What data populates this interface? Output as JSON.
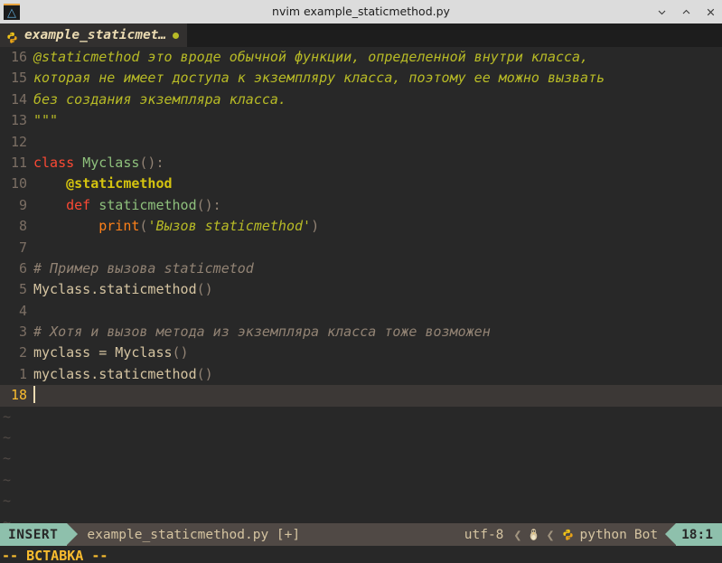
{
  "window": {
    "title": "nvim example_staticmethod.py",
    "app_icon": "neovim-icon",
    "controls": [
      {
        "name": "minimize-button",
        "glyph": "chevron-down-icon"
      },
      {
        "name": "maximize-button",
        "glyph": "chevron-up-icon"
      },
      {
        "name": "close-button",
        "glyph": "close-icon"
      }
    ]
  },
  "tabline": {
    "active_tab": {
      "icon": "python-icon",
      "label": "example_staticmet…",
      "modified_indicator": "●"
    }
  },
  "editor": {
    "lines": [
      {
        "num": "16",
        "tokens": [
          {
            "cls": "t-doc",
            "text": "@staticmethod это вроде обычной функции, определенной внутри класса,"
          }
        ]
      },
      {
        "num": "15",
        "tokens": [
          {
            "cls": "t-doc",
            "text": "которая не имеет доступа к экземпляру класса, поэтому ее можно вызвать"
          }
        ]
      },
      {
        "num": "14",
        "tokens": [
          {
            "cls": "t-doc",
            "text": "без создания экземпляра класса."
          }
        ]
      },
      {
        "num": "13",
        "tokens": [
          {
            "cls": "t-doc",
            "text": "\"\"\""
          }
        ]
      },
      {
        "num": "12",
        "tokens": []
      },
      {
        "num": "11",
        "tokens": [
          {
            "cls": "t-kw",
            "text": "class"
          },
          {
            "cls": "t-op",
            "text": " "
          },
          {
            "cls": "t-fn",
            "text": "Myclass"
          },
          {
            "cls": "t-punc",
            "text": "():"
          }
        ]
      },
      {
        "num": "10",
        "tokens": [
          {
            "cls": "t-op",
            "text": "    "
          },
          {
            "cls": "t-deco",
            "text": "@staticmethod"
          }
        ]
      },
      {
        "num": "9",
        "tokens": [
          {
            "cls": "t-op",
            "text": "    "
          },
          {
            "cls": "t-kw",
            "text": "def"
          },
          {
            "cls": "t-op",
            "text": " "
          },
          {
            "cls": "t-fn",
            "text": "staticmethod"
          },
          {
            "cls": "t-punc",
            "text": "():"
          }
        ]
      },
      {
        "num": "8",
        "tokens": [
          {
            "cls": "t-op",
            "text": "        "
          },
          {
            "cls": "t-builtin",
            "text": "print"
          },
          {
            "cls": "t-punc",
            "text": "("
          },
          {
            "cls": "t-str",
            "text": "'Вызов staticmethod'"
          },
          {
            "cls": "t-punc",
            "text": ")"
          }
        ]
      },
      {
        "num": "7",
        "tokens": []
      },
      {
        "num": "6",
        "tokens": [
          {
            "cls": "t-cmt",
            "text": "# Пример вызова staticmetod"
          }
        ]
      },
      {
        "num": "5",
        "tokens": [
          {
            "cls": "t-text",
            "text": "Myclass.staticmethod"
          },
          {
            "cls": "t-punc",
            "text": "()"
          }
        ]
      },
      {
        "num": "4",
        "tokens": []
      },
      {
        "num": "3",
        "tokens": [
          {
            "cls": "t-cmt",
            "text": "# Хотя и вызов метода из экземпляра класса тоже возможен"
          }
        ]
      },
      {
        "num": "2",
        "tokens": [
          {
            "cls": "t-text",
            "text": "myclass "
          },
          {
            "cls": "t-op",
            "text": "="
          },
          {
            "cls": "t-text",
            "text": " Myclass"
          },
          {
            "cls": "t-punc",
            "text": "()"
          }
        ]
      },
      {
        "num": "1",
        "tokens": [
          {
            "cls": "t-text",
            "text": "myclass.staticmethod"
          },
          {
            "cls": "t-punc",
            "text": "()"
          }
        ]
      }
    ],
    "cursor_line": {
      "num": "18",
      "text": ""
    },
    "empty_markers": [
      "~",
      "~",
      "~",
      "~",
      "~",
      "~"
    ]
  },
  "statusline": {
    "mode": "INSERT",
    "filename": "example_staticmethod.py [+]",
    "encoding": "utf-8",
    "os_icon": "linux-penguin-icon",
    "filetype_icon": "python-icon",
    "filetype": "python",
    "scroll_position": "Bot",
    "line_col": "18:1"
  },
  "cmdline": {
    "message": "-- ВСТАВКА --"
  },
  "colors": {
    "editor_bg": "#282828",
    "cursorline_bg": "#3c3836",
    "statusline_bg": "#504945",
    "accent_teal": "#8ec0ac",
    "titlebar_bg": "#dcdcdc",
    "tabline_bg": "#1d1d1d",
    "tab_active_bg": "#32302f",
    "string_green": "#b8bb26",
    "keyword_red": "#fb4934",
    "function_green": "#8ec07c",
    "builtin_orange": "#fe8019",
    "comment_gray": "#928374",
    "linenr_yellow": "#fabd2f"
  }
}
